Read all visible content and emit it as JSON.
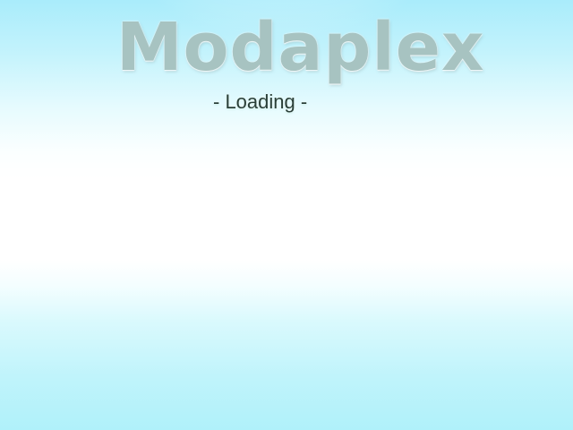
{
  "game": {
    "title": "Modaplex",
    "status": "- Loading -"
  },
  "colors": {
    "sky_top": "#a9ecfb",
    "sky_middle": "#ffffff",
    "sky_bottom": "#b0f1fa",
    "logo": "#a7c3c1",
    "status_text": "#2a3f38"
  }
}
